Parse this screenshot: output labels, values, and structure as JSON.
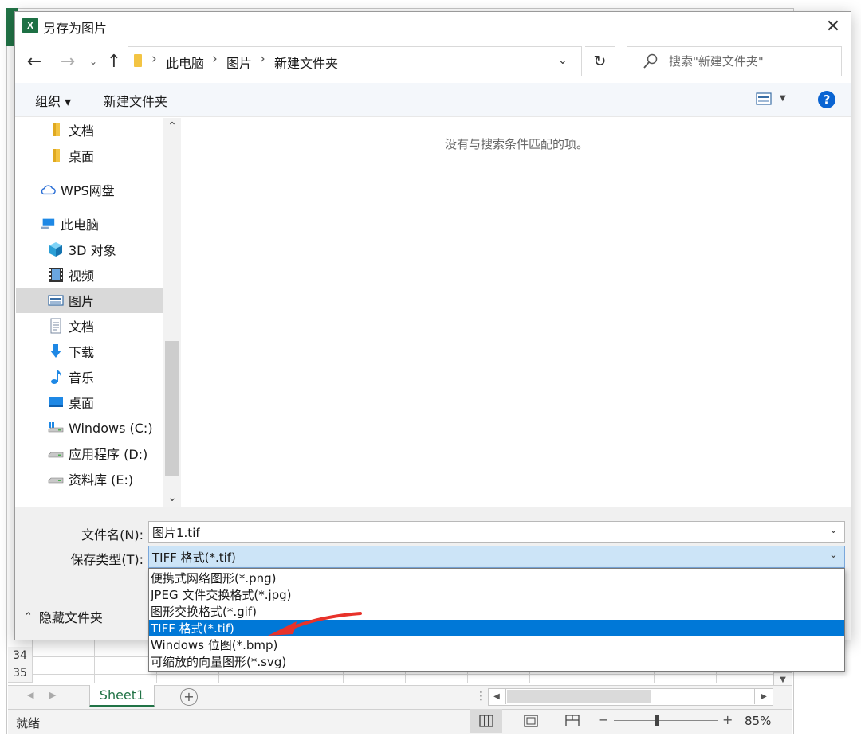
{
  "excel": {
    "rows": [
      "34",
      "35"
    ],
    "sheet_tab": "Sheet1",
    "add_sheet": "+",
    "status": "就绪",
    "zoom_minus": "−",
    "zoom_plus": "+",
    "zoom": "85%"
  },
  "dialog": {
    "title": "另存为图片",
    "close": "✕",
    "nav": {
      "back": "←",
      "forward": "→",
      "recent": "⌄",
      "up": "↑"
    },
    "breadcrumb": [
      "此电脑",
      "图片",
      "新建文件夹"
    ],
    "breadcrumb_sep": "›",
    "refresh": "↻",
    "search_placeholder": "搜索\"新建文件夹\"",
    "toolbar": {
      "organize": "组织 ▾",
      "new_folder": "新建文件夹",
      "help": "?"
    },
    "sidebar": [
      {
        "label": "文档",
        "icon": "folder-icon"
      },
      {
        "label": "桌面",
        "icon": "folder-icon"
      },
      {
        "label": "WPS网盘",
        "icon": "cloud-icon"
      },
      {
        "label": "此电脑",
        "icon": "computer-icon"
      },
      {
        "label": "3D 对象",
        "icon": "cube-icon"
      },
      {
        "label": "视频",
        "icon": "video-icon"
      },
      {
        "label": "图片",
        "icon": "pictures-icon",
        "selected": true
      },
      {
        "label": "文档",
        "icon": "document-icon"
      },
      {
        "label": "下载",
        "icon": "download-icon"
      },
      {
        "label": "音乐",
        "icon": "music-icon"
      },
      {
        "label": "桌面",
        "icon": "desktop-icon"
      },
      {
        "label": "Windows (C:)",
        "icon": "drive-icon"
      },
      {
        "label": "应用程序 (D:)",
        "icon": "drive-icon"
      },
      {
        "label": "资料库 (E:)",
        "icon": "drive-icon"
      }
    ],
    "empty_message": "没有与搜索条件匹配的项。",
    "filename_label": "文件名(N):",
    "filename_value": "图片1.tif",
    "filetype_label": "保存类型(T):",
    "filetype_value": "TIFF 格式(*.tif)",
    "hide_folders": "隐藏文件夹",
    "filetype_options": [
      "便携式网络图形(*.png)",
      "JPEG 文件交换格式(*.jpg)",
      "图形交换格式(*.gif)",
      "TIFF 格式(*.tif)",
      "Windows 位图(*.bmp)",
      "可缩放的向量图形(*.svg)"
    ],
    "selected_option_index": 3
  },
  "colors": {
    "excel_green": "#217346",
    "selection_blue": "#0078d7",
    "annotation_arrow": "#e8322a"
  }
}
